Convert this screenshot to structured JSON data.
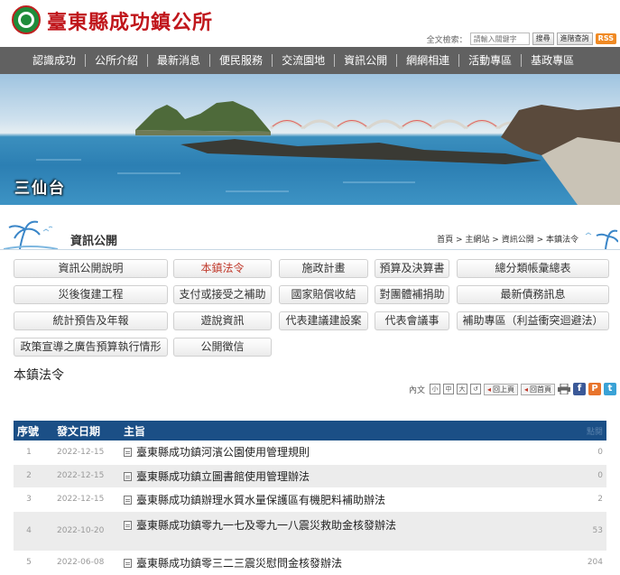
{
  "header": {
    "site_title": "臺東縣成功鎮公所",
    "search_label": "全文檢索：",
    "search_placeholder": "請輸入關鍵字",
    "search_button": "搜尋",
    "advanced_button": "進階查詢",
    "rss_label": "RSS"
  },
  "nav": {
    "items": [
      "認識成功",
      "公所介紹",
      "最新消息",
      "便民服務",
      "交流園地",
      "資訊公開",
      "網網相連",
      "活動專區",
      "基政專區"
    ]
  },
  "banner": {
    "title": "三仙台"
  },
  "section": {
    "title": "資訊公開",
    "breadcrumb": [
      "首頁",
      "主網站",
      "資訊公開",
      "本鎮法令"
    ]
  },
  "categories": [
    {
      "label": "資訊公開說明",
      "active": false
    },
    {
      "label": "本鎮法令",
      "active": true
    },
    {
      "label": "施政計畫",
      "active": false
    },
    {
      "label": "預算及決算書",
      "active": false
    },
    {
      "label": "總分類帳彙總表",
      "active": false
    },
    {
      "label": "災後復建工程",
      "active": false
    },
    {
      "label": "支付或接受之補助",
      "active": false
    },
    {
      "label": "國家賠償收結",
      "active": false
    },
    {
      "label": "對團體補捐助",
      "active": false
    },
    {
      "label": "最新債務訊息",
      "active": false
    },
    {
      "label": "統計預告及年報",
      "active": false
    },
    {
      "label": "遊說資訊",
      "active": false
    },
    {
      "label": "代表建議建設案",
      "active": false
    },
    {
      "label": "代表會議事",
      "active": false
    },
    {
      "label": "補助專區（利益衝突迴避法）",
      "active": false
    },
    {
      "label": "政策宣導之廣告預算執行情形",
      "active": false
    },
    {
      "label": "公開徵信",
      "active": false
    }
  ],
  "page_heading": "本鎮法令",
  "toolbar": {
    "text_size_label": "內文",
    "sizes": [
      "小",
      "中",
      "大"
    ],
    "back_label": "回上頁",
    "home_label": "回首頁"
  },
  "table": {
    "headers": {
      "no": "序號",
      "date": "發文日期",
      "subject": "主旨",
      "views": "點閱"
    },
    "rows": [
      {
        "no": "1",
        "date": "2022-12-15",
        "subject": "臺東縣成功鎮河濱公園使用管理規則",
        "views": "0"
      },
      {
        "no": "2",
        "date": "2022-12-15",
        "subject": "臺東縣成功鎮立圖書館使用管理辦法",
        "views": "0"
      },
      {
        "no": "3",
        "date": "2022-12-15",
        "subject": "臺東縣成功鎮辦理水質水量保護區有機肥料補助辦法",
        "views": "2"
      },
      {
        "no": "4",
        "date": "2022-10-20",
        "subject": "臺東縣成功鎮零九一七及零九一八震災救助金核發辦法",
        "views": "53"
      },
      {
        "no": "5",
        "date": "2022-06-08",
        "subject": "臺東縣成功鎮零三二三震災慰問金核發辦法",
        "views": "204"
      }
    ]
  },
  "colors": {
    "nav_bg": "#616161",
    "table_header": "#1b4f86",
    "title_red": "#c0161b"
  }
}
